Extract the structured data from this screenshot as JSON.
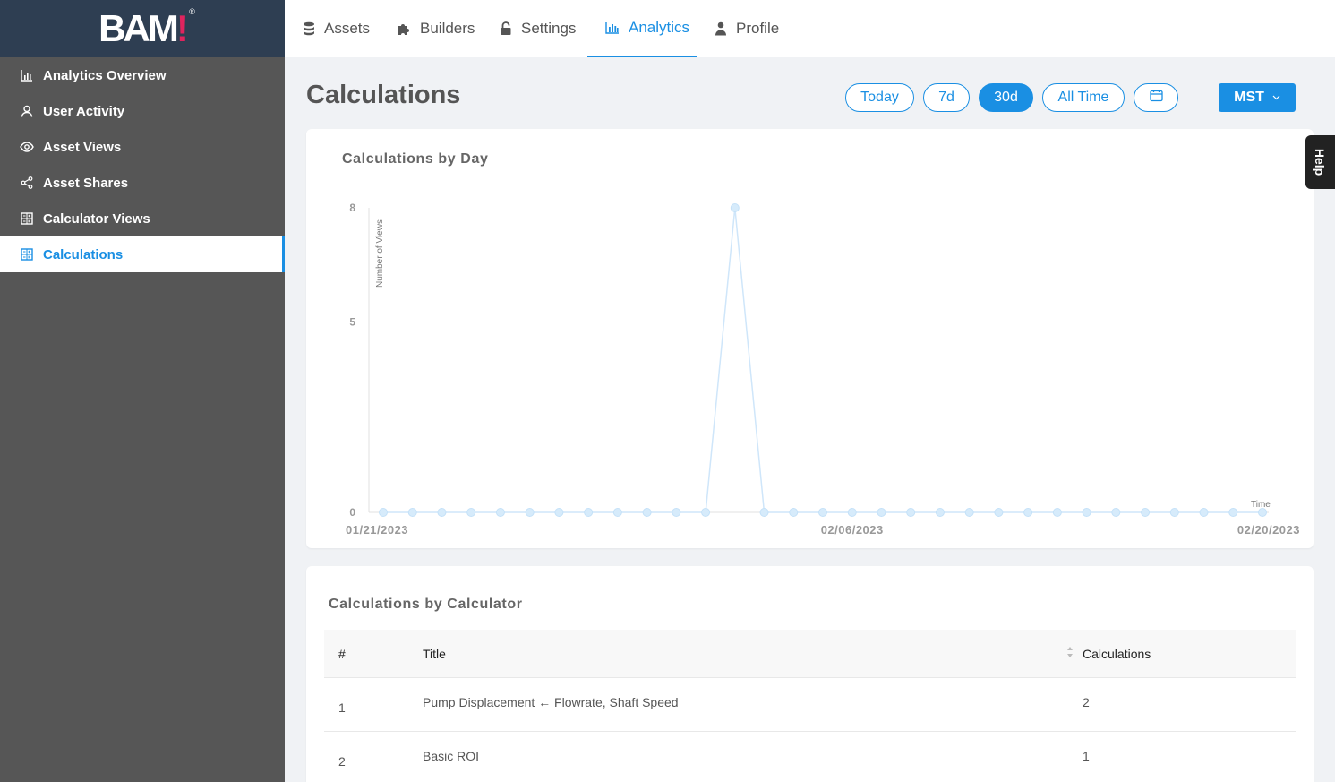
{
  "brand": {
    "logo_text": "BAM",
    "logo_bang": "!",
    "logo_reg": "®"
  },
  "sidebar": {
    "items": [
      {
        "label": "Analytics Overview",
        "icon": "bar-chart-icon",
        "active": false
      },
      {
        "label": "User Activity",
        "icon": "user-icon",
        "active": false
      },
      {
        "label": "Asset Views",
        "icon": "eye-icon",
        "active": false
      },
      {
        "label": "Asset Shares",
        "icon": "share-icon",
        "active": false
      },
      {
        "label": "Calculator Views",
        "icon": "calculator-icon",
        "active": false
      },
      {
        "label": "Calculations",
        "icon": "calculator-icon",
        "active": true
      }
    ]
  },
  "topnav": {
    "tabs": [
      {
        "label": "Assets",
        "icon": "database-icon",
        "active": false
      },
      {
        "label": "Builders",
        "icon": "puzzle-icon",
        "active": false
      },
      {
        "label": "Settings",
        "icon": "lock-icon",
        "active": false
      },
      {
        "label": "Analytics",
        "icon": "bar-chart-icon",
        "active": true
      },
      {
        "label": "Profile",
        "icon": "person-icon",
        "active": false
      }
    ]
  },
  "header": {
    "title": "Calculations",
    "ranges": [
      "Today",
      "7d",
      "30d",
      "All Time"
    ],
    "active_range": "30d",
    "calendar_icon": "calendar-icon",
    "timezone": "MST",
    "help_label": "Help"
  },
  "colors": {
    "accent": "#1a8fe3",
    "sidebar_bg": "#565656",
    "brand_bg": "#2e3e52",
    "logo_bang": "#e0245e",
    "line": "#cfe6fa"
  },
  "chart_card": {
    "title": "Calculations by Day"
  },
  "chart_data": {
    "type": "line",
    "title": "Calculations by Day",
    "xlabel": "Time",
    "ylabel": "Number of Views",
    "ylim": [
      0,
      8
    ],
    "yticks": [
      0,
      5,
      8
    ],
    "x_tick_labels": [
      "01/21/2023",
      "02/06/2023",
      "02/20/2023"
    ],
    "x": [
      "01/21/2023",
      "01/22/2023",
      "01/23/2023",
      "01/24/2023",
      "01/25/2023",
      "01/26/2023",
      "01/27/2023",
      "01/28/2023",
      "01/29/2023",
      "01/30/2023",
      "01/31/2023",
      "02/01/2023",
      "02/02/2023",
      "02/03/2023",
      "02/04/2023",
      "02/05/2023",
      "02/06/2023",
      "02/07/2023",
      "02/08/2023",
      "02/09/2023",
      "02/10/2023",
      "02/11/2023",
      "02/12/2023",
      "02/13/2023",
      "02/14/2023",
      "02/15/2023",
      "02/16/2023",
      "02/17/2023",
      "02/18/2023",
      "02/19/2023",
      "02/20/2023"
    ],
    "values": [
      0,
      0,
      0,
      0,
      0,
      0,
      0,
      0,
      0,
      0,
      0,
      0,
      8,
      0,
      0,
      0,
      0,
      0,
      0,
      0,
      0,
      0,
      0,
      0,
      0,
      0,
      0,
      0,
      0,
      0,
      0
    ]
  },
  "table_card": {
    "title": "Calculations by Calculator",
    "columns": [
      "#",
      "Title",
      "Calculations"
    ],
    "rows": [
      {
        "num": "1",
        "title": "Pump Displacement ← Flowrate, Shaft Speed",
        "calcs": "2"
      },
      {
        "num": "2",
        "title": "Basic ROI",
        "calcs": "1"
      }
    ]
  }
}
